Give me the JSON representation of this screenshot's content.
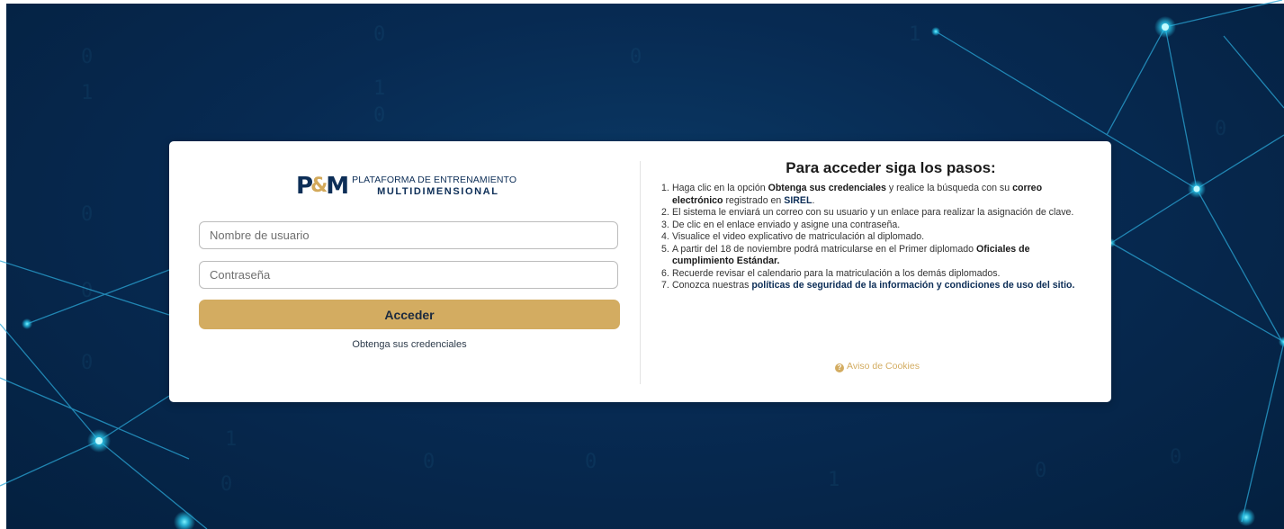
{
  "logo": {
    "mark_p": "P",
    "mark_amp": "&",
    "mark_m": "M",
    "line1": "PLATAFORMA DE ENTRENAMIENTO",
    "line2": "MULTIDIMENSIONAL"
  },
  "login": {
    "username_placeholder": "Nombre de usuario",
    "password_placeholder": "Contraseña",
    "submit_label": "Acceder",
    "credentials_link": "Obtenga sus credenciales"
  },
  "instructions": {
    "title": "Para acceder siga los pasos:",
    "steps": [
      {
        "num": "1.",
        "a": "Haga clic en la opción ",
        "b1": "Obtenga sus credenciales",
        "c": " y realice la búsqueda con su ",
        "b2": "correo electrónico",
        "d": " registrado en ",
        "b3": "SIREL",
        "e": "."
      },
      {
        "num": "2.",
        "text": "El sistema le enviará un correo con su usuario y un enlace para realizar la asignación de clave."
      },
      {
        "num": "3.",
        "text": "De clic en el enlace enviado y asigne una contraseña."
      },
      {
        "num": "4.",
        "text": "Visualice el video explicativo de matriculación al diplomado."
      },
      {
        "num": "5.",
        "a": "A partir del 18 de noviembre podrá matricularse en el Primer diplomado ",
        "b1": "Oficiales de cumplimiento Estándar."
      },
      {
        "num": "6.",
        "text": "Recuerde revisar el calendario para la matriculación a los demás diplomados."
      },
      {
        "num": "7.",
        "a": "Conozca nuestras ",
        "b1": "políticas de seguridad de la información y condiciones de uso del sitio."
      }
    ]
  },
  "cookies": {
    "icon": "question-circle-icon",
    "label": "Aviso de Cookies"
  },
  "colors": {
    "background": "#072a52",
    "accent_gold": "#d3ac61",
    "brand_navy": "#0d2e57"
  }
}
